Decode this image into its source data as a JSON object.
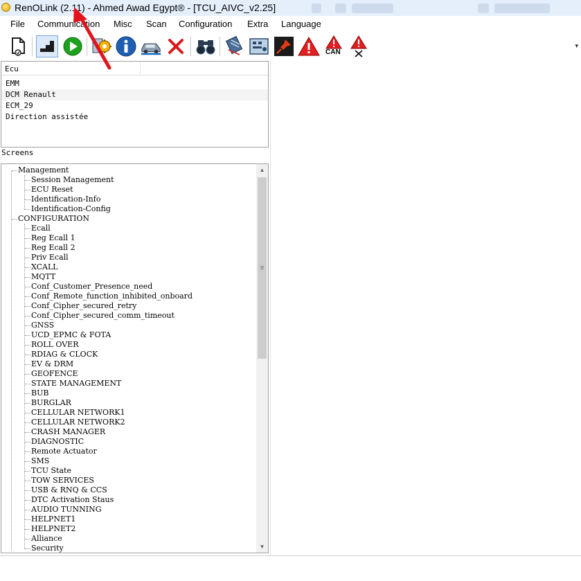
{
  "window": {
    "title": "RenOLink (2.11) - Ahmed Awad Egypt® -  [TCU_AIVC_v2.25]"
  },
  "menu": [
    "File",
    "Communication",
    "Misc",
    "Scan",
    "Configuration",
    "Extra",
    "Language"
  ],
  "toolbar": {
    "buttons": [
      {
        "name": "document-icon"
      },
      {
        "name": "steps-icon"
      },
      {
        "name": "play-icon"
      },
      {
        "name": "gear-config-icon"
      },
      {
        "name": "info-icon"
      },
      {
        "name": "car-icon"
      },
      {
        "name": "close-x-icon"
      },
      {
        "name": "binoculars-icon"
      },
      {
        "name": "chip-icon"
      },
      {
        "name": "module-icon"
      },
      {
        "name": "pin-icon"
      },
      {
        "name": "warning-icon"
      },
      {
        "name": "warning-can-icon",
        "label": "CAN"
      },
      {
        "name": "warning-clear-icon"
      }
    ],
    "overflow": "▾"
  },
  "ecu": {
    "header": "Ecu",
    "items": [
      "EMM",
      "DCM Renault",
      "ECM_29",
      "Direction assistée"
    ]
  },
  "screens": {
    "label": "Screens",
    "groups": [
      {
        "label": "Management",
        "items": [
          "Session Management",
          "ECU Reset",
          "Identification-Info",
          "Identification-Config"
        ]
      },
      {
        "label": "CONFIGURATION",
        "items": [
          "Ecall",
          "Reg Ecall 1",
          "Reg Ecall 2",
          "Priv Ecall",
          "XCALL",
          "MQTT",
          "Conf_Customer_Presence_need",
          "Conf_Remote_function_inhibited_onboard",
          "Conf_Cipher_secured_retry",
          "Conf_Cipher_secured_comm_timeout",
          "GNSS",
          "UCD_EPMC & FOTA",
          "ROLL OVER",
          "RDIAG & CLOCK",
          "EV & DRM",
          "GEOFENCE",
          "STATE MANAGEMENT",
          "BUB",
          "BURGLAR",
          "CELLULAR NETWORK1",
          "CELLULAR NETWORK2",
          "CRASH MANAGER",
          "DIAGNOSTIC",
          "Remote Actuator",
          "SMS",
          "TCU State",
          "TOW SERVICES",
          "USB & RNQ & CCS",
          "DTC Activation Staus",
          "AUDIO TUNNING",
          "HELPNET1",
          "HELPNET2",
          "Alliance",
          "Security"
        ]
      }
    ]
  },
  "colors": {
    "titlebar": "#e4effb",
    "annotation_arrow": "#e0141e"
  }
}
